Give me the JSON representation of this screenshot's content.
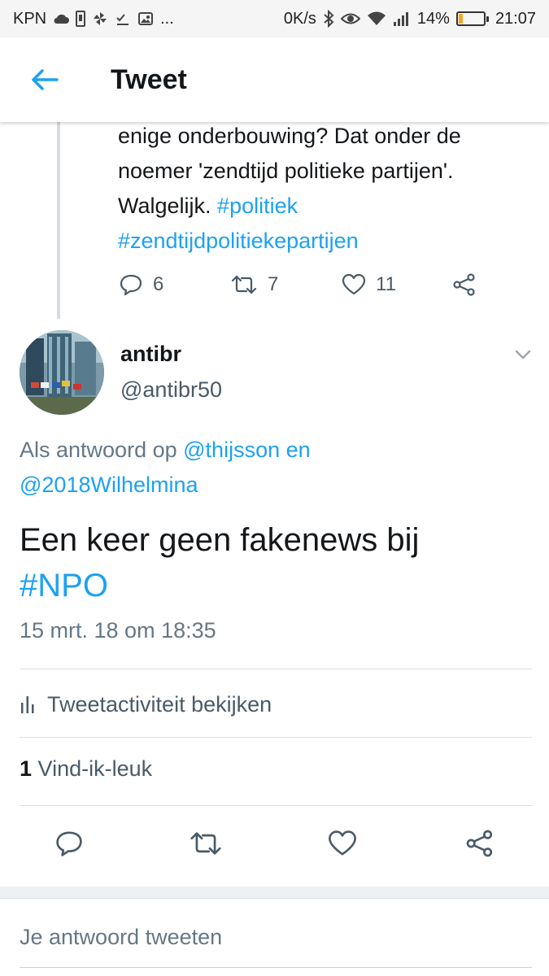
{
  "statusbar": {
    "carrier": "KPN",
    "network_speed": "0K/s",
    "battery_percent": "14%",
    "time": "21:07",
    "more": "..."
  },
  "header": {
    "title": "Tweet"
  },
  "prev_tweet": {
    "text_plain": "enige onderbouwing? Dat onder de noemer 'zendtijd politieke partijen'. Walgelijk.",
    "hashtag1": "#politiek",
    "hashtag2": "#zendtijdpolitiekepartijen",
    "replies": "6",
    "retweets": "7",
    "likes": "11"
  },
  "tweet": {
    "name": "antibr",
    "handle": "@antibr50",
    "reply_prefix": "Als antwoord op",
    "reply_user1": "@thijsson",
    "reply_conj": "en",
    "reply_user2": "@2018Wilhelmina",
    "text": "Een keer geen fakenews bij",
    "hashtag": "#NPO",
    "timestamp": "15 mrt. 18 om 18:35",
    "activity_label": "Tweetactiviteit bekijken",
    "like_count": "1",
    "like_label": "Vind-ik-leuk"
  },
  "reply_bar": {
    "placeholder": "Je antwoord tweeten"
  },
  "colors": {
    "accent": "#1da1f2",
    "secondary_text": "#657786",
    "icon": "#4a5a68"
  }
}
